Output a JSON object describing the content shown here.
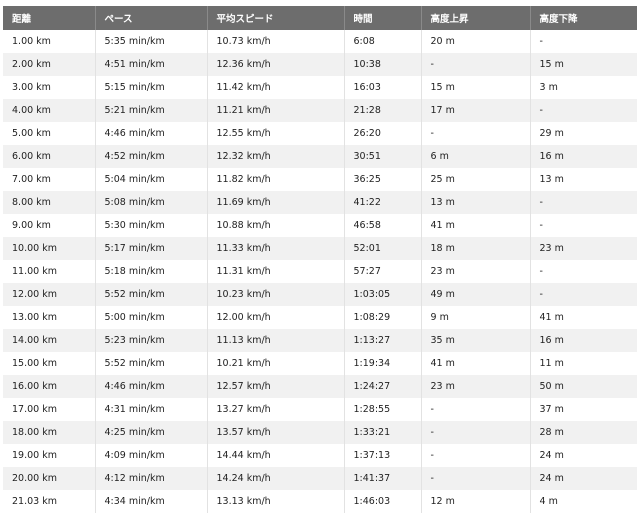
{
  "table": {
    "headers": [
      "距離",
      "ペース",
      "平均スピード",
      "時間",
      "高度上昇",
      "高度下降"
    ],
    "rows": [
      [
        "1.00 km",
        "5:35 min/km",
        "10.73 km/h",
        "6:08",
        "20 m",
        "-"
      ],
      [
        "2.00 km",
        "4:51 min/km",
        "12.36 km/h",
        "10:38",
        "-",
        "15 m"
      ],
      [
        "3.00 km",
        "5:15 min/km",
        "11.42 km/h",
        "16:03",
        "15 m",
        "3 m"
      ],
      [
        "4.00 km",
        "5:21 min/km",
        "11.21 km/h",
        "21:28",
        "17 m",
        "-"
      ],
      [
        "5.00 km",
        "4:46 min/km",
        "12.55 km/h",
        "26:20",
        "-",
        "29 m"
      ],
      [
        "6.00 km",
        "4:52 min/km",
        "12.32 km/h",
        "30:51",
        "6 m",
        "16 m"
      ],
      [
        "7.00 km",
        "5:04 min/km",
        "11.82 km/h",
        "36:25",
        "25 m",
        "13 m"
      ],
      [
        "8.00 km",
        "5:08 min/km",
        "11.69 km/h",
        "41:22",
        "13 m",
        "-"
      ],
      [
        "9.00 km",
        "5:30 min/km",
        "10.88 km/h",
        "46:58",
        "41 m",
        "-"
      ],
      [
        "10.00 km",
        "5:17 min/km",
        "11.33 km/h",
        "52:01",
        "18 m",
        "23 m"
      ],
      [
        "11.00 km",
        "5:18 min/km",
        "11.31 km/h",
        "57:27",
        "23 m",
        "-"
      ],
      [
        "12.00 km",
        "5:52 min/km",
        "10.23 km/h",
        "1:03:05",
        "49 m",
        "-"
      ],
      [
        "13.00 km",
        "5:00 min/km",
        "12.00 km/h",
        "1:08:29",
        "9 m",
        "41 m"
      ],
      [
        "14.00 km",
        "5:23 min/km",
        "11.13 km/h",
        "1:13:27",
        "35 m",
        "16 m"
      ],
      [
        "15.00 km",
        "5:52 min/km",
        "10.21 km/h",
        "1:19:34",
        "41 m",
        "11 m"
      ],
      [
        "16.00 km",
        "4:46 min/km",
        "12.57 km/h",
        "1:24:27",
        "23 m",
        "50 m"
      ],
      [
        "17.00 km",
        "4:31 min/km",
        "13.27 km/h",
        "1:28:55",
        "-",
        "37 m"
      ],
      [
        "18.00 km",
        "4:25 min/km",
        "13.57 km/h",
        "1:33:21",
        "-",
        "28 m"
      ],
      [
        "19.00 km",
        "4:09 min/km",
        "14.44 km/h",
        "1:37:13",
        "-",
        "24 m"
      ],
      [
        "20.00 km",
        "4:12 min/km",
        "14.24 km/h",
        "1:41:37",
        "-",
        "24 m"
      ],
      [
        "21.03 km",
        "4:34 min/km",
        "13.13 km/h",
        "1:46:03",
        "12 m",
        "4 m"
      ]
    ]
  },
  "colors": {
    "header_background": "#6d6d6d",
    "header_text": "#ffffff",
    "row_stripe": "#f1f1f1",
    "row_plain": "#ffffff"
  }
}
